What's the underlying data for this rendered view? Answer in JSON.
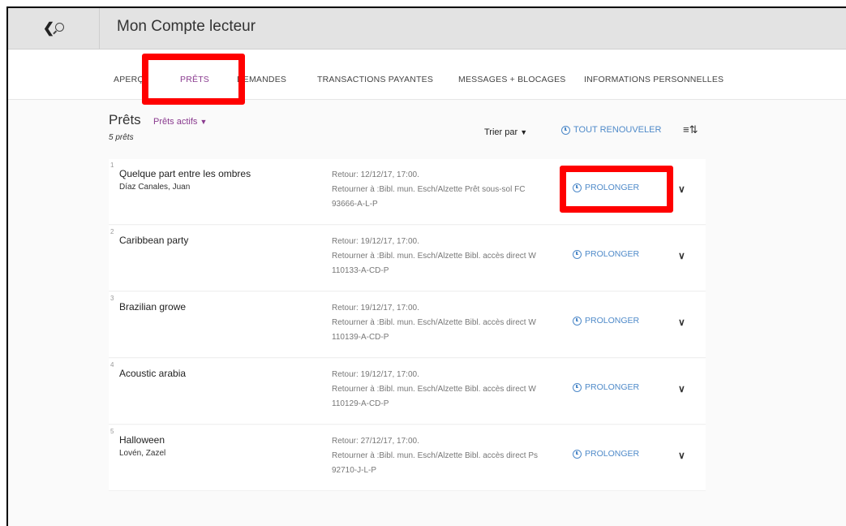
{
  "header": {
    "title": "Mon Compte lecteur"
  },
  "tabs": [
    {
      "label": "APERÇU",
      "active": false
    },
    {
      "label": "PRÊTS",
      "active": true
    },
    {
      "label": "DEMANDES",
      "active": false
    },
    {
      "label": "TRANSACTIONS PAYANTES",
      "active": false
    },
    {
      "label": "MESSAGES + BLOCAGES",
      "active": false
    },
    {
      "label": "INFORMATIONS PERSONNELLES",
      "active": false
    }
  ],
  "loans": {
    "title": "Prêts",
    "filter": "Prêts actifs",
    "count": "5 prêts",
    "sort_label": "Trier par",
    "renew_all": "TOUT RENOUVELER"
  },
  "items": [
    {
      "num": "1",
      "title": "Quelque part entre les ombres",
      "author": "Díaz Canales, Juan",
      "due": "Retour: 12/12/17, 17:00.",
      "return_to": "Retourner à :Bibl. mun. Esch/Alzette Prêt sous-sol FC 93666-A-L-P",
      "extend": "PROLONGER"
    },
    {
      "num": "2",
      "title": "Caribbean party",
      "author": "",
      "due": "Retour: 19/12/17, 17:00.",
      "return_to": "Retourner à :Bibl. mun. Esch/Alzette Bibl. accès direct W 110133-A-CD-P",
      "extend": "PROLONGER"
    },
    {
      "num": "3",
      "title": "Brazilian growe",
      "author": "",
      "due": "Retour: 19/12/17, 17:00.",
      "return_to": "Retourner à :Bibl. mun. Esch/Alzette Bibl. accès direct W 110139-A-CD-P",
      "extend": "PROLONGER"
    },
    {
      "num": "4",
      "title": "Acoustic arabia",
      "author": "",
      "due": "Retour: 19/12/17, 17:00.",
      "return_to": "Retourner à :Bibl. mun. Esch/Alzette Bibl. accès direct W 110129-A-CD-P",
      "extend": "PROLONGER"
    },
    {
      "num": "5",
      "title": "Halloween",
      "author": "Lovén, Zazel",
      "due": "Retour: 27/12/17, 17:00.",
      "return_to": "Retourner à :Bibl. mun. Esch/Alzette Bibl. accès direct Ps 92710-J-L-P",
      "extend": "PROLONGER"
    }
  ],
  "colors": {
    "accent": "#8a3b8f",
    "link": "#4f8ac9",
    "highlight": "#ff0000"
  }
}
